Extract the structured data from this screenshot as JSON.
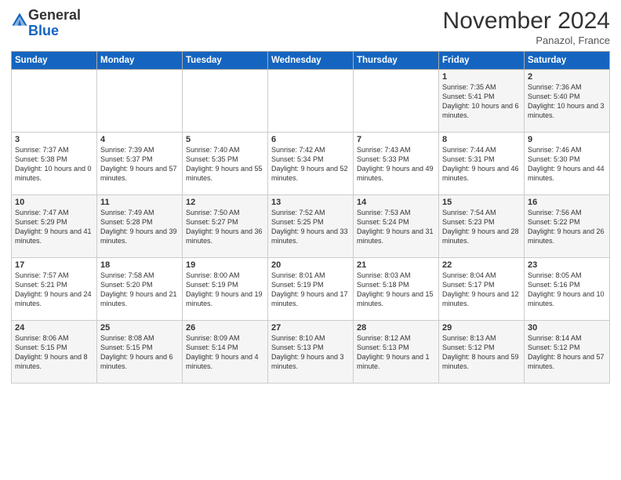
{
  "header": {
    "logo_line1": "General",
    "logo_line2": "Blue",
    "month": "November 2024",
    "location": "Panazol, France"
  },
  "weekdays": [
    "Sunday",
    "Monday",
    "Tuesday",
    "Wednesday",
    "Thursday",
    "Friday",
    "Saturday"
  ],
  "weeks": [
    [
      {
        "day": "",
        "detail": ""
      },
      {
        "day": "",
        "detail": ""
      },
      {
        "day": "",
        "detail": ""
      },
      {
        "day": "",
        "detail": ""
      },
      {
        "day": "",
        "detail": ""
      },
      {
        "day": "1",
        "detail": "Sunrise: 7:35 AM\nSunset: 5:41 PM\nDaylight: 10 hours\nand 6 minutes."
      },
      {
        "day": "2",
        "detail": "Sunrise: 7:36 AM\nSunset: 5:40 PM\nDaylight: 10 hours\nand 3 minutes."
      }
    ],
    [
      {
        "day": "3",
        "detail": "Sunrise: 7:37 AM\nSunset: 5:38 PM\nDaylight: 10 hours\nand 0 minutes."
      },
      {
        "day": "4",
        "detail": "Sunrise: 7:39 AM\nSunset: 5:37 PM\nDaylight: 9 hours\nand 57 minutes."
      },
      {
        "day": "5",
        "detail": "Sunrise: 7:40 AM\nSunset: 5:35 PM\nDaylight: 9 hours\nand 55 minutes."
      },
      {
        "day": "6",
        "detail": "Sunrise: 7:42 AM\nSunset: 5:34 PM\nDaylight: 9 hours\nand 52 minutes."
      },
      {
        "day": "7",
        "detail": "Sunrise: 7:43 AM\nSunset: 5:33 PM\nDaylight: 9 hours\nand 49 minutes."
      },
      {
        "day": "8",
        "detail": "Sunrise: 7:44 AM\nSunset: 5:31 PM\nDaylight: 9 hours\nand 46 minutes."
      },
      {
        "day": "9",
        "detail": "Sunrise: 7:46 AM\nSunset: 5:30 PM\nDaylight: 9 hours\nand 44 minutes."
      }
    ],
    [
      {
        "day": "10",
        "detail": "Sunrise: 7:47 AM\nSunset: 5:29 PM\nDaylight: 9 hours\nand 41 minutes."
      },
      {
        "day": "11",
        "detail": "Sunrise: 7:49 AM\nSunset: 5:28 PM\nDaylight: 9 hours\nand 39 minutes."
      },
      {
        "day": "12",
        "detail": "Sunrise: 7:50 AM\nSunset: 5:27 PM\nDaylight: 9 hours\nand 36 minutes."
      },
      {
        "day": "13",
        "detail": "Sunrise: 7:52 AM\nSunset: 5:25 PM\nDaylight: 9 hours\nand 33 minutes."
      },
      {
        "day": "14",
        "detail": "Sunrise: 7:53 AM\nSunset: 5:24 PM\nDaylight: 9 hours\nand 31 minutes."
      },
      {
        "day": "15",
        "detail": "Sunrise: 7:54 AM\nSunset: 5:23 PM\nDaylight: 9 hours\nand 28 minutes."
      },
      {
        "day": "16",
        "detail": "Sunrise: 7:56 AM\nSunset: 5:22 PM\nDaylight: 9 hours\nand 26 minutes."
      }
    ],
    [
      {
        "day": "17",
        "detail": "Sunrise: 7:57 AM\nSunset: 5:21 PM\nDaylight: 9 hours\nand 24 minutes."
      },
      {
        "day": "18",
        "detail": "Sunrise: 7:58 AM\nSunset: 5:20 PM\nDaylight: 9 hours\nand 21 minutes."
      },
      {
        "day": "19",
        "detail": "Sunrise: 8:00 AM\nSunset: 5:19 PM\nDaylight: 9 hours\nand 19 minutes."
      },
      {
        "day": "20",
        "detail": "Sunrise: 8:01 AM\nSunset: 5:19 PM\nDaylight: 9 hours\nand 17 minutes."
      },
      {
        "day": "21",
        "detail": "Sunrise: 8:03 AM\nSunset: 5:18 PM\nDaylight: 9 hours\nand 15 minutes."
      },
      {
        "day": "22",
        "detail": "Sunrise: 8:04 AM\nSunset: 5:17 PM\nDaylight: 9 hours\nand 12 minutes."
      },
      {
        "day": "23",
        "detail": "Sunrise: 8:05 AM\nSunset: 5:16 PM\nDaylight: 9 hours\nand 10 minutes."
      }
    ],
    [
      {
        "day": "24",
        "detail": "Sunrise: 8:06 AM\nSunset: 5:15 PM\nDaylight: 9 hours\nand 8 minutes."
      },
      {
        "day": "25",
        "detail": "Sunrise: 8:08 AM\nSunset: 5:15 PM\nDaylight: 9 hours\nand 6 minutes."
      },
      {
        "day": "26",
        "detail": "Sunrise: 8:09 AM\nSunset: 5:14 PM\nDaylight: 9 hours\nand 4 minutes."
      },
      {
        "day": "27",
        "detail": "Sunrise: 8:10 AM\nSunset: 5:13 PM\nDaylight: 9 hours\nand 3 minutes."
      },
      {
        "day": "28",
        "detail": "Sunrise: 8:12 AM\nSunset: 5:13 PM\nDaylight: 9 hours\nand 1 minute."
      },
      {
        "day": "29",
        "detail": "Sunrise: 8:13 AM\nSunset: 5:12 PM\nDaylight: 8 hours\nand 59 minutes."
      },
      {
        "day": "30",
        "detail": "Sunrise: 8:14 AM\nSunset: 5:12 PM\nDaylight: 8 hours\nand 57 minutes."
      }
    ]
  ]
}
